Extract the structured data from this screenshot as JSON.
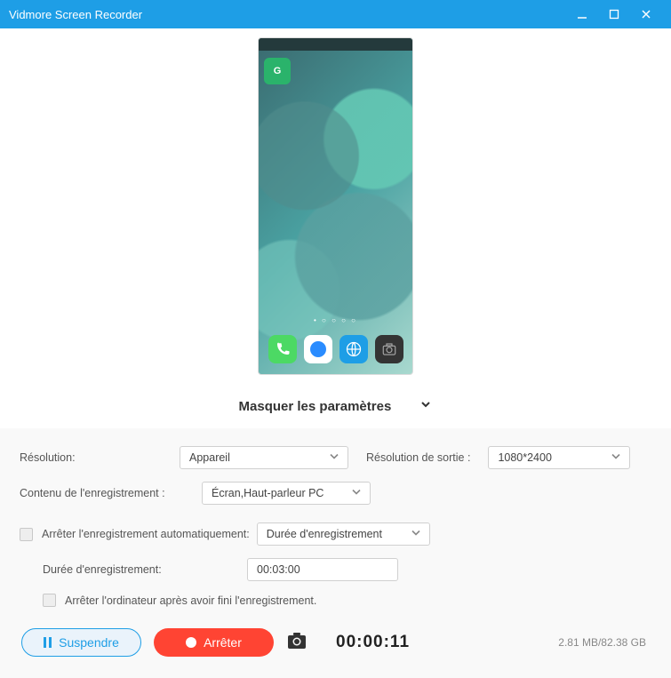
{
  "window": {
    "title": "Vidmore Screen Recorder"
  },
  "toggle_label": "Masquer les paramètres",
  "settings": {
    "resolution_label": "Résolution:",
    "resolution_value": "Appareil",
    "output_res_label": "Résolution de sortie :",
    "output_res_value": "1080*2400",
    "content_label": "Contenu de l'enregistrement :",
    "content_value": "Écran,Haut-parleur PC",
    "autostop_label": "Arrêter l'enregistrement automatiquement:",
    "autostop_type": "Durée d'enregistrement",
    "duration_label": "Durée d'enregistrement:",
    "duration_value": "00:03:00",
    "shutdown_label": "Arrêter l'ordinateur après avoir fini l'enregistrement."
  },
  "controls": {
    "pause_label": "Suspendre",
    "stop_label": "Arrêter",
    "timer": "00:00:11",
    "storage": "2.81 MB/82.38 GB"
  },
  "phone": {
    "app_badge": "G"
  }
}
